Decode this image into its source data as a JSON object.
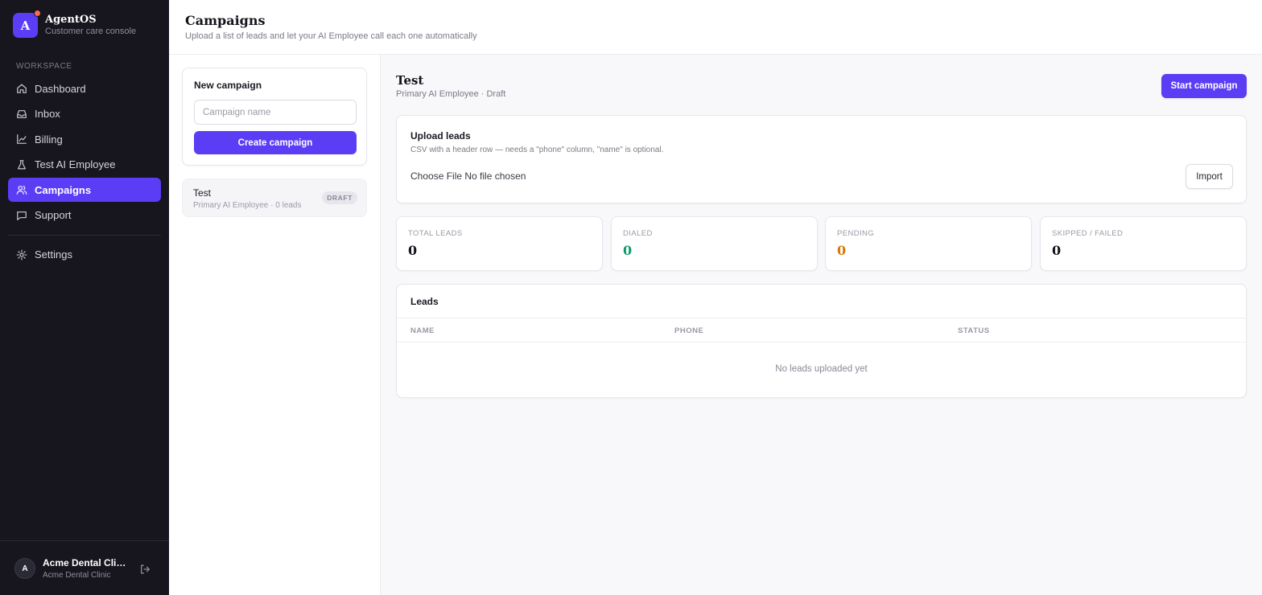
{
  "brand": {
    "logo_letter": "A",
    "name": "AgentOS",
    "subtitle": "Customer care console"
  },
  "sidebar": {
    "section_label": "WORKSPACE",
    "items": [
      {
        "label": "Dashboard",
        "icon": "home-icon"
      },
      {
        "label": "Inbox",
        "icon": "inbox-icon"
      },
      {
        "label": "Billing",
        "icon": "chart-line-icon"
      },
      {
        "label": "Test AI Employee",
        "icon": "flask-icon"
      },
      {
        "label": "Campaigns",
        "icon": "users-icon",
        "active": true
      },
      {
        "label": "Support",
        "icon": "message-icon"
      }
    ],
    "settings_label": "Settings",
    "footer": {
      "avatar_letter": "A",
      "name": "Acme Dental Clinic...",
      "org": "Acme Dental Clinic"
    }
  },
  "header": {
    "title": "Campaigns",
    "subtitle": "Upload a list of leads and let your AI Employee call each one automatically"
  },
  "new_campaign": {
    "title": "New campaign",
    "input_placeholder": "Campaign name",
    "input_value": "",
    "button_label": "Create campaign"
  },
  "campaign_list": [
    {
      "name": "Test",
      "meta": "Primary AI Employee · 0 leads",
      "badge": "DRAFT"
    }
  ],
  "detail": {
    "title": "Test",
    "subtitle": "Primary AI Employee · Draft",
    "start_button": "Start campaign",
    "upload": {
      "title": "Upload leads",
      "description": "CSV with a header row — needs a \"phone\" column, \"name\" is optional.",
      "file_button": "Choose File",
      "file_status": "No file chosen",
      "import_button": "Import"
    },
    "stats": [
      {
        "label": "TOTAL LEADS",
        "value": "0",
        "color": "#15141c"
      },
      {
        "label": "DIALED",
        "value": "0",
        "color": "#0f9a6e"
      },
      {
        "label": "PENDING",
        "value": "0",
        "color": "#d9770b"
      },
      {
        "label": "SKIPPED / FAILED",
        "value": "0",
        "color": "#15141c"
      }
    ],
    "leads": {
      "title": "Leads",
      "columns": [
        "NAME",
        "PHONE",
        "STATUS"
      ],
      "rows": [],
      "empty_text": "No leads uploaded yet"
    }
  },
  "colors": {
    "accent": "#5b3df5",
    "sidebar_bg": "#17161f",
    "notification_dot": "#ff6a4d"
  }
}
